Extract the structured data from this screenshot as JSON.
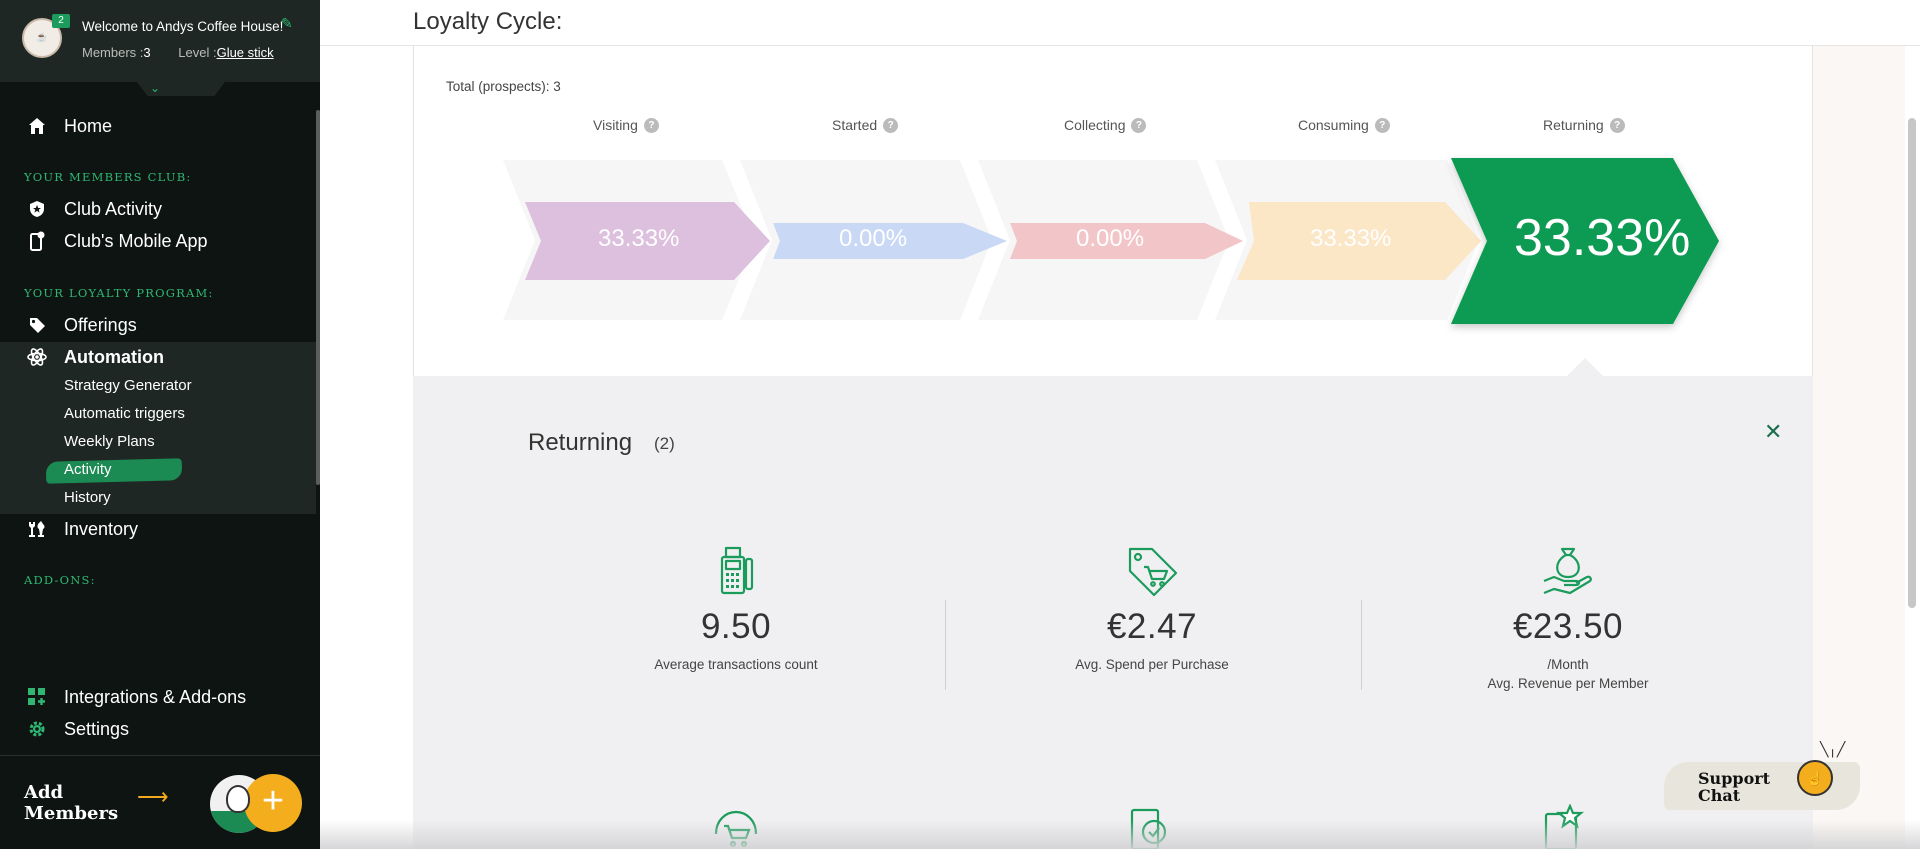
{
  "sidebar": {
    "welcome": "Welcome to Andys Coffee House!",
    "badge": "2",
    "members_label": "Members :",
    "members_count": "3",
    "level_label": "Level :",
    "level_value": "Glue stick",
    "home": "Home",
    "section_club": "YOUR MEMBERS CLUB:",
    "club_activity": "Club Activity",
    "club_app": "Club's Mobile App",
    "section_loyalty": "YOUR LOYALTY PROGRAM:",
    "offerings": "Offerings",
    "automation": "Automation",
    "sub": [
      "Strategy Generator",
      "Automatic triggers",
      "Weekly Plans",
      "Activity",
      "History"
    ],
    "inventory": "Inventory",
    "section_addons": "ADD-ONS:",
    "integrations": "Integrations & Add-ons",
    "settings": "Settings",
    "add_members_1": "Add",
    "add_members_2": "Members"
  },
  "main": {
    "title": "Loyalty Cycle:",
    "total": "Total (prospects): 3",
    "stages": [
      {
        "label": "Visiting",
        "pct": "33.33%",
        "color": "#dcc0de"
      },
      {
        "label": "Started",
        "pct": "0.00%",
        "color": "#c9d8f4"
      },
      {
        "label": "Collecting",
        "pct": "0.00%",
        "color": "#f2c6c8"
      },
      {
        "label": "Consuming",
        "pct": "33.33%",
        "color": "#fbe6c6"
      },
      {
        "label": "Returning",
        "pct": "33.33%",
        "color": "#0a9a52"
      }
    ]
  },
  "detail": {
    "title": "Returning",
    "count": "(2)",
    "close": "✕",
    "stats": [
      {
        "value": "9.50",
        "caption": "Average transactions count",
        "caption2": ""
      },
      {
        "value": "€2.47",
        "caption": "Avg. Spend per Purchase",
        "caption2": ""
      },
      {
        "value": "€23.50",
        "caption": "/Month",
        "caption2": "Avg. Revenue per Member"
      }
    ]
  },
  "support": {
    "line1": "Support",
    "line2": "Chat"
  },
  "colors": {
    "accent": "#2fb673",
    "sidebar_bg": "#0e1411",
    "green_dark": "#0a9a52",
    "orange": "#f4ad1d"
  }
}
